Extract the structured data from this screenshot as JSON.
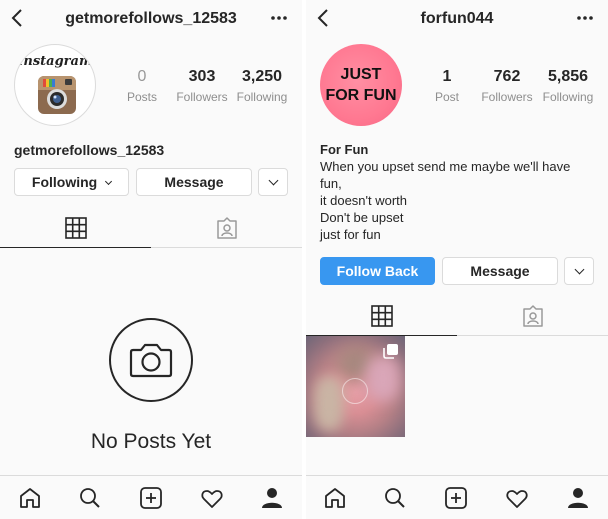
{
  "left": {
    "username": "getmorefollows_12583",
    "avatar_word": "Instagram",
    "stats": [
      {
        "num": "0",
        "label": "Posts"
      },
      {
        "num": "303",
        "label": "Followers"
      },
      {
        "num": "3,250",
        "label": "Following"
      }
    ],
    "display_name": "getmorefollows_12583",
    "following_button": "Following",
    "message_button": "Message",
    "empty_text": "No Posts Yet"
  },
  "right": {
    "username": "forfun044",
    "avatar_line1": "JUST",
    "avatar_line2": "FOR FUN",
    "stats": [
      {
        "num": "1",
        "label": "Post"
      },
      {
        "num": "762",
        "label": "Followers"
      },
      {
        "num": "5,856",
        "label": "Following"
      }
    ],
    "bio_name": "For Fun",
    "bio_lines": [
      "When you upset send me maybe we'll have",
      "fun,",
      "it doesn't worth",
      "Don't be upset",
      "just for fun"
    ],
    "follow_back_button": "Follow Back",
    "message_button": "Message"
  },
  "icons": {
    "back": "chevron-left-icon",
    "more": "more-dots-icon",
    "grid": "grid-icon",
    "tagged": "tagged-icon",
    "home": "home-icon",
    "search": "search-icon",
    "new_post": "plus-square-icon",
    "activity": "heart-icon",
    "profile": "profile-icon"
  },
  "colors": {
    "accent": "#3897f0",
    "avatar_pink": "#ff7891"
  }
}
